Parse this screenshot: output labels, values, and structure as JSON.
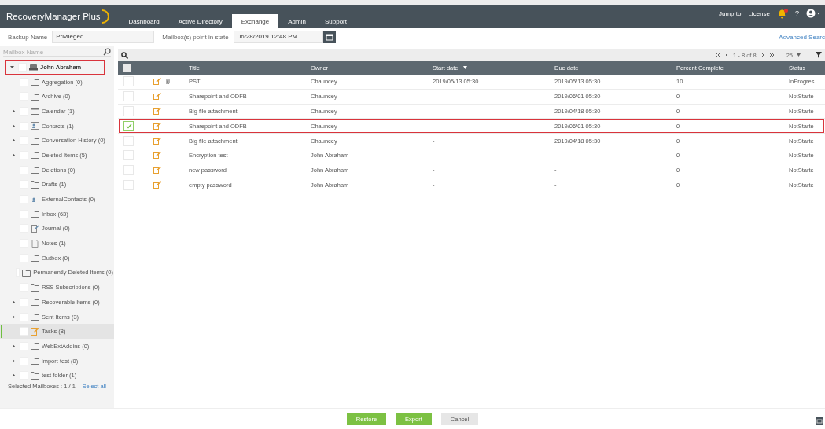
{
  "header": {
    "logo": "RecoveryManager Plus",
    "tabs": [
      {
        "label": "Dashboard",
        "selected": false
      },
      {
        "label": "Active Directory",
        "selected": false
      },
      {
        "label": "Exchange",
        "selected": true
      },
      {
        "label": "Admin",
        "selected": false
      },
      {
        "label": "Support",
        "selected": false
      }
    ],
    "links": [
      "Jump to",
      "License"
    ],
    "help": "?"
  },
  "toolbar": {
    "backup_label": "Backup Name",
    "backup_value": "Privileged",
    "state_label": "Mailbox(s) point in state",
    "state_value": "06/28/2019 12:48 PM",
    "advanced_link": "Advanced Searc"
  },
  "sidebar": {
    "search": {
      "placeholder": "Mailbox Name"
    },
    "tree": [
      {
        "label": "John Abraham",
        "kind": "mailbox",
        "expandable": true,
        "expanded": true,
        "highlighted": true,
        "selected": false,
        "children": [
          {
            "label": "Aggregation (0)",
            "kind": "folder",
            "expandable": false,
            "selected": false
          },
          {
            "label": "Archive (0)",
            "kind": "folder",
            "expandable": false,
            "selected": false
          },
          {
            "label": "Calendar (1)",
            "kind": "calendar",
            "expandable": true,
            "expanded": false,
            "selected": false
          },
          {
            "label": "Contacts (1)",
            "kind": "contacts",
            "expandable": true,
            "expanded": false,
            "selected": false
          },
          {
            "label": "Conversation History (0)",
            "kind": "folder",
            "expandable": true,
            "expanded": false,
            "selected": false
          },
          {
            "label": "Deleted Items (5)",
            "kind": "folder",
            "expandable": true,
            "expanded": false,
            "selected": false
          },
          {
            "label": "Deletions (0)",
            "kind": "folder",
            "expandable": false,
            "selected": false
          },
          {
            "label": "Drafts (1)",
            "kind": "folder",
            "expandable": false,
            "selected": false
          },
          {
            "label": "ExternalContacts (0)",
            "kind": "contacts",
            "expandable": false,
            "selected": false
          },
          {
            "label": "Inbox (63)",
            "kind": "folder",
            "expandable": false,
            "selected": false
          },
          {
            "label": "Journal (0)",
            "kind": "journal",
            "expandable": false,
            "selected": false
          },
          {
            "label": "Notes (1)",
            "kind": "note",
            "expandable": false,
            "selected": false
          },
          {
            "label": "Outbox (0)",
            "kind": "folder",
            "expandable": false,
            "selected": false
          },
          {
            "label": "Permanently Deleted Items (0)",
            "kind": "folder",
            "expandable": false,
            "selected": false
          },
          {
            "label": "RSS Subscriptions (0)",
            "kind": "folder",
            "expandable": false,
            "selected": false
          },
          {
            "label": "Recoverable Items (0)",
            "kind": "folder",
            "expandable": true,
            "expanded": false,
            "selected": false
          },
          {
            "label": "Sent Items (3)",
            "kind": "folder",
            "expandable": true,
            "expanded": false,
            "selected": false
          },
          {
            "label": "Tasks (8)",
            "kind": "task",
            "expandable": false,
            "selected": true
          },
          {
            "label": "WebExtAddins (0)",
            "kind": "folder",
            "expandable": true,
            "expanded": false,
            "selected": false
          },
          {
            "label": "import test (0)",
            "kind": "folder",
            "expandable": true,
            "expanded": false,
            "selected": false
          },
          {
            "label": "test folder (1)",
            "kind": "folder",
            "expandable": true,
            "expanded": false,
            "selected": false
          }
        ]
      }
    ],
    "selected_text": "Selected Mailboxes : 1 / 1",
    "select_all": "Select all"
  },
  "table": {
    "all_checked": false,
    "pager": "1 - 8 of 8",
    "page_size": "25",
    "columns": [
      "Title",
      "Owner",
      "Start date",
      "Due date",
      "Percent Complete",
      "Status"
    ],
    "rows": [
      {
        "checked": false,
        "highlighted": false,
        "attachment": true,
        "cells": [
          "PST",
          "Chauncey",
          "2019/05/13 05:30",
          "2019/05/13 05:30",
          "10",
          "InProgres"
        ]
      },
      {
        "checked": false,
        "highlighted": false,
        "attachment": false,
        "cells": [
          "Sharepoint and ODFB",
          "Chauncey",
          "-",
          "2019/06/01 05:30",
          "0",
          "NotStarte"
        ]
      },
      {
        "checked": false,
        "highlighted": false,
        "attachment": false,
        "cells": [
          "Big file attachment",
          "Chauncey",
          "-",
          "2019/04/18 05:30",
          "0",
          "NotStarte"
        ]
      },
      {
        "checked": true,
        "highlighted": true,
        "attachment": false,
        "cells": [
          "Sharepoint and ODFB",
          "Chauncey",
          "-",
          "2019/06/01 05:30",
          "0",
          "NotStarte"
        ]
      },
      {
        "checked": false,
        "highlighted": false,
        "attachment": false,
        "cells": [
          "Big file attachment",
          "Chauncey",
          "-",
          "2019/04/18 05:30",
          "0",
          "NotStarte"
        ]
      },
      {
        "checked": false,
        "highlighted": false,
        "attachment": false,
        "cells": [
          "Encryption test",
          "John Abraham",
          "-",
          "-",
          "0",
          "NotStarte"
        ]
      },
      {
        "checked": false,
        "highlighted": false,
        "attachment": false,
        "cells": [
          "new password",
          "John Abraham",
          "-",
          "-",
          "0",
          "NotStarte"
        ]
      },
      {
        "checked": false,
        "highlighted": false,
        "attachment": false,
        "cells": [
          "empty password",
          "John Abraham",
          "-",
          "-",
          "0",
          "NotStarte"
        ]
      }
    ]
  },
  "footer": {
    "buttons": [
      {
        "label": "Restore",
        "kind": "primary"
      },
      {
        "label": "Export",
        "kind": "primary"
      },
      {
        "label": "Cancel",
        "kind": "secondary"
      }
    ]
  }
}
